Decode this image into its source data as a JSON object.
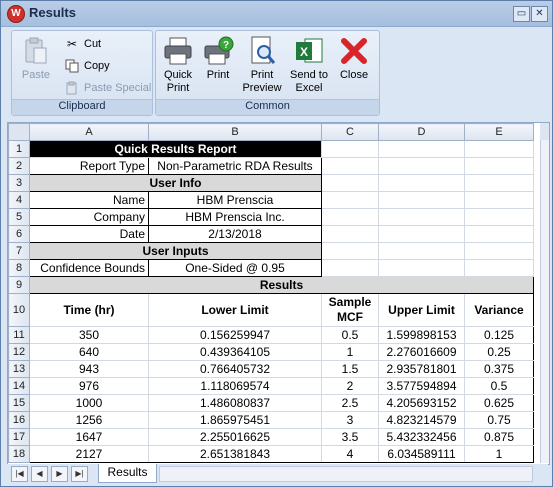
{
  "window": {
    "title": "Results"
  },
  "ribbon": {
    "clipboard": {
      "label": "Clipboard",
      "paste": "Paste",
      "cut": "Cut",
      "copy": "Copy",
      "paste_special": "Paste Special"
    },
    "common": {
      "label": "Common",
      "quick_print": "Quick Print",
      "print": "Print",
      "print_preview": "Print Preview",
      "send_to_excel": "Send to Excel",
      "close": "Close"
    }
  },
  "sheet": {
    "columns": [
      "A",
      "B",
      "C",
      "D",
      "E"
    ],
    "rows": [
      "1",
      "2",
      "3",
      "4",
      "5",
      "6",
      "7",
      "8",
      "9",
      "10",
      "11",
      "12",
      "13",
      "14",
      "15",
      "16",
      "17",
      "18"
    ],
    "report_title": "Quick Results Report",
    "report_type_label": "Report Type",
    "report_type_value": "Non-Parametric RDA Results",
    "user_info_title": "User Info",
    "name_label": "Name",
    "name_value": "HBM Prenscia",
    "company_label": "Company",
    "company_value": "HBM Prenscia Inc.",
    "date_label": "Date",
    "date_value": "2/13/2018",
    "user_inputs_title": "User Inputs",
    "cb_label": "Confidence Bounds",
    "cb_value": "One-Sided @ 0.95",
    "results_title": "Results",
    "results_headers": [
      "Time (hr)",
      "Lower Limit",
      "Sample MCF",
      "Upper Limit",
      "Variance"
    ],
    "results_rows": [
      [
        "350",
        "0.156259947",
        "0.5",
        "1.599898153",
        "0.125"
      ],
      [
        "640",
        "0.439364105",
        "1",
        "2.276016609",
        "0.25"
      ],
      [
        "943",
        "0.766405732",
        "1.5",
        "2.935781801",
        "0.375"
      ],
      [
        "976",
        "1.118069574",
        "2",
        "3.577594894",
        "0.5"
      ],
      [
        "1000",
        "1.486080837",
        "2.5",
        "4.205693152",
        "0.625"
      ],
      [
        "1256",
        "1.865975451",
        "3",
        "4.823214579",
        "0.75"
      ],
      [
        "1647",
        "2.255016625",
        "3.5",
        "5.432332456",
        "0.875"
      ],
      [
        "2127",
        "2.651381843",
        "4",
        "6.034589111",
        "1"
      ]
    ]
  },
  "tabs": {
    "active": "Results"
  }
}
